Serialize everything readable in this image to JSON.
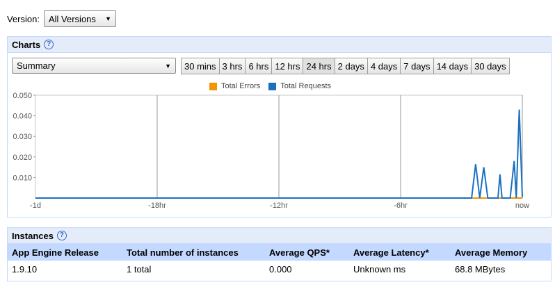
{
  "version": {
    "label": "Version:",
    "selected": "All Versions"
  },
  "charts": {
    "title": "Charts",
    "view_selected": "Summary",
    "time_ranges": [
      "30 mins",
      "3 hrs",
      "6 hrs",
      "12 hrs",
      "24 hrs",
      "2 days",
      "4 days",
      "7 days",
      "14 days",
      "30 days"
    ],
    "active_range": "24 hrs"
  },
  "chart_data": {
    "type": "line",
    "legend_position": "top",
    "grid": true,
    "x_labels": [
      "-1d",
      "-18hr",
      "-12hr",
      "-6hr",
      "now"
    ],
    "ylim": [
      0,
      0.05
    ],
    "y_ticks": [
      "0.050",
      "0.040",
      "0.030",
      "0.020",
      "0.010"
    ],
    "x": [
      -24,
      -2.5,
      -2.3,
      -2.1,
      -1.9,
      -1.7,
      -1.5,
      -1.2,
      -1.1,
      -1.0,
      -0.6,
      -0.4,
      -0.3,
      -0.15,
      0
    ],
    "series": [
      {
        "name": "Total Errors",
        "color": "#f29500",
        "values": [
          0,
          0,
          0,
          0,
          0,
          0,
          0,
          0,
          0,
          0,
          0,
          0,
          0,
          0,
          0
        ]
      },
      {
        "name": "Total Requests",
        "color": "#1c70c0",
        "values": [
          0,
          0,
          0.0165,
          0,
          0.015,
          0,
          0,
          0,
          0.0115,
          0,
          0,
          0.018,
          0,
          0.043,
          0.0005
        ]
      }
    ]
  },
  "instances": {
    "title": "Instances",
    "columns": [
      "App Engine Release",
      "Total number of instances",
      "Average QPS*",
      "Average Latency*",
      "Average Memory"
    ],
    "rows": [
      [
        "1.9.10",
        "1 total",
        "0.000",
        "Unknown ms",
        "68.8 MBytes"
      ]
    ]
  },
  "colors": {
    "accent": "#c3d9ff",
    "header_bg": "#e5ecf9",
    "link": "#3366cc"
  },
  "icons": {
    "help": "help-circle-icon",
    "dropdown": "triangle-down-icon"
  }
}
